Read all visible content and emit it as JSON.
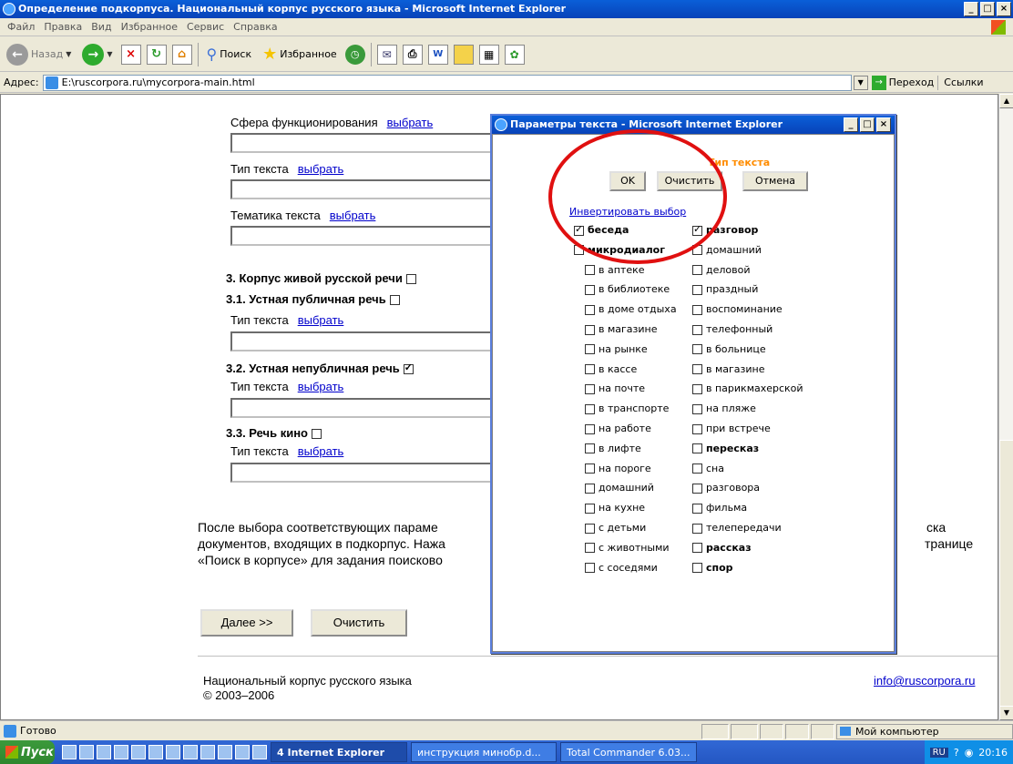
{
  "window": {
    "title": "Определение подкорпуса. Национальный корпус русского языка - Microsoft Internet Explorer",
    "controls": [
      "_",
      "□",
      "×"
    ]
  },
  "menu": [
    "Файл",
    "Правка",
    "Вид",
    "Избранное",
    "Сервис",
    "Справка"
  ],
  "toolbar": {
    "back": "Назад",
    "search": "Поиск",
    "favorites": "Избранное"
  },
  "address": {
    "label": "Адрес:",
    "value": "E:\\ruscorpora.ru\\mycorpora-main.html",
    "go": "Переход",
    "links": "Ссылки"
  },
  "page": {
    "sphere_label": "Сфера функционирования",
    "choose": "выбрать",
    "text_type_label": "Тип текста",
    "theme_label": "Тематика текста",
    "sec3": "3. Корпус живой русской речи",
    "sec31": "3.1. Устная публичная речь",
    "sec32": "3.2. Устная непубличная речь",
    "sec33": "3.3. Речь кино",
    "para_line1a": "После выбора соответствующих параме",
    "para_line1b": "ска",
    "para_line2a": "документов, входящих в подкорпус. Нажа",
    "para_line2b": "транице",
    "para_line3a": "«Поиск в корпусе» для задания поисково",
    "next_button": "Далее >>",
    "clear_button": "Очистить",
    "footer_org": "Национальный корпус русского языка",
    "footer_years": "© 2003–2006",
    "footer_email": "info@ruscorpora.ru"
  },
  "dialog": {
    "title": "Параметры текста - Microsoft Internet Explorer",
    "heading": "Тип текста",
    "ok": "OK",
    "clear": "Очистить",
    "cancel": "Отмена",
    "invert": "Инвертировать выбор",
    "left_col": [
      {
        "label": "беседа",
        "checked": true,
        "bold": true
      },
      {
        "label": "микродиалог",
        "checked": false,
        "bold": true
      },
      {
        "label": "в аптеке",
        "checked": false,
        "bold": false
      },
      {
        "label": "в библиотеке",
        "checked": false,
        "bold": false
      },
      {
        "label": "в доме отдыха",
        "checked": false,
        "bold": false
      },
      {
        "label": "в магазине",
        "checked": false,
        "bold": false
      },
      {
        "label": "на рынке",
        "checked": false,
        "bold": false
      },
      {
        "label": "в кассе",
        "checked": false,
        "bold": false
      },
      {
        "label": "на почте",
        "checked": false,
        "bold": false
      },
      {
        "label": "в транспорте",
        "checked": false,
        "bold": false
      },
      {
        "label": "на работе",
        "checked": false,
        "bold": false
      },
      {
        "label": "в лифте",
        "checked": false,
        "bold": false
      },
      {
        "label": "на пороге",
        "checked": false,
        "bold": false
      },
      {
        "label": "домашний",
        "checked": false,
        "bold": false
      },
      {
        "label": "на кухне",
        "checked": false,
        "bold": false
      },
      {
        "label": "с детьми",
        "checked": false,
        "bold": false
      },
      {
        "label": "с животными",
        "checked": false,
        "bold": false
      },
      {
        "label": "с соседями",
        "checked": false,
        "bold": false
      }
    ],
    "right_col": [
      {
        "label": "разговор",
        "checked": true,
        "bold": true
      },
      {
        "label": "домашний",
        "checked": false,
        "bold": false
      },
      {
        "label": "деловой",
        "checked": false,
        "bold": false
      },
      {
        "label": "праздный",
        "checked": false,
        "bold": false
      },
      {
        "label": "воспоминание",
        "checked": false,
        "bold": false
      },
      {
        "label": "телефонный",
        "checked": false,
        "bold": false
      },
      {
        "label": "в больнице",
        "checked": false,
        "bold": false
      },
      {
        "label": "в магазине",
        "checked": false,
        "bold": false
      },
      {
        "label": "в парикмахерской",
        "checked": false,
        "bold": false
      },
      {
        "label": "на пляже",
        "checked": false,
        "bold": false
      },
      {
        "label": "при встрече",
        "checked": false,
        "bold": false
      },
      {
        "label": "пересказ",
        "checked": false,
        "bold": true
      },
      {
        "label": "сна",
        "checked": false,
        "bold": false
      },
      {
        "label": "разговора",
        "checked": false,
        "bold": false
      },
      {
        "label": "фильма",
        "checked": false,
        "bold": false
      },
      {
        "label": "телепередачи",
        "checked": false,
        "bold": false
      },
      {
        "label": "рассказ",
        "checked": false,
        "bold": true
      },
      {
        "label": "спор",
        "checked": false,
        "bold": true
      }
    ]
  },
  "status": {
    "left": "Готово",
    "zone": "Мой компьютер"
  },
  "taskbar": {
    "start": "Пуск",
    "tasks": [
      "4 Internet Explorer",
      "инструкция минобр.d...",
      "Total Commander 6.03..."
    ],
    "lang": "RU",
    "time": "20:16"
  }
}
